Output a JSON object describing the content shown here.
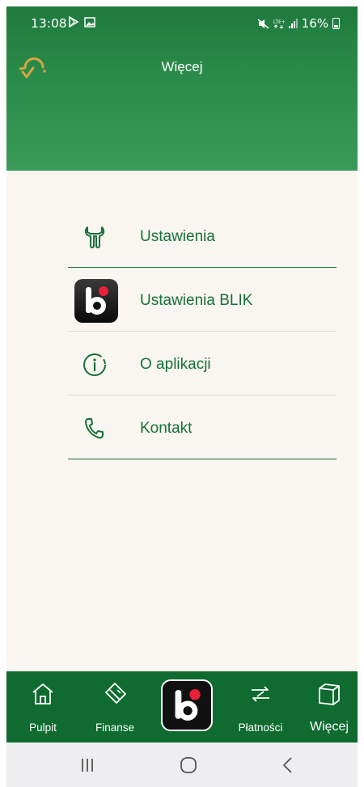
{
  "status_bar": {
    "time": "13:08",
    "battery_percent": "16%",
    "icons_left": [
      "play-store-icon",
      "gallery-icon"
    ],
    "icons_right": [
      "mute-icon",
      "lte-icon",
      "signal-icon",
      "battery-icon"
    ]
  },
  "header": {
    "title": "Więcej",
    "back_icon": "undo-arrow-icon",
    "color_top": "#1f7a3d",
    "color_bottom": "#3a9a57"
  },
  "menu": {
    "items": [
      {
        "label": "Ustawienia",
        "icon": "wrench-icon"
      },
      {
        "label": "Ustawienia BLIK",
        "icon": "blik-icon"
      },
      {
        "label": "O aplikacji",
        "icon": "info-icon"
      },
      {
        "label": "Kontakt",
        "icon": "phone-icon"
      }
    ],
    "text_color": "#17703a"
  },
  "bottom_nav": {
    "items": [
      {
        "label": "Pulpit",
        "icon": "home-icon"
      },
      {
        "label": "Finanse",
        "icon": "card-icon"
      },
      {
        "label": "",
        "icon": "blik-icon"
      },
      {
        "label": "Płatności",
        "icon": "transfer-icon"
      },
      {
        "label": "Więcej",
        "icon": "box-icon",
        "active": true
      }
    ],
    "background": "#0f6b2f"
  },
  "system_nav": {
    "buttons": [
      "recent-apps-icon",
      "home-circle-icon",
      "back-chevron-icon"
    ]
  }
}
